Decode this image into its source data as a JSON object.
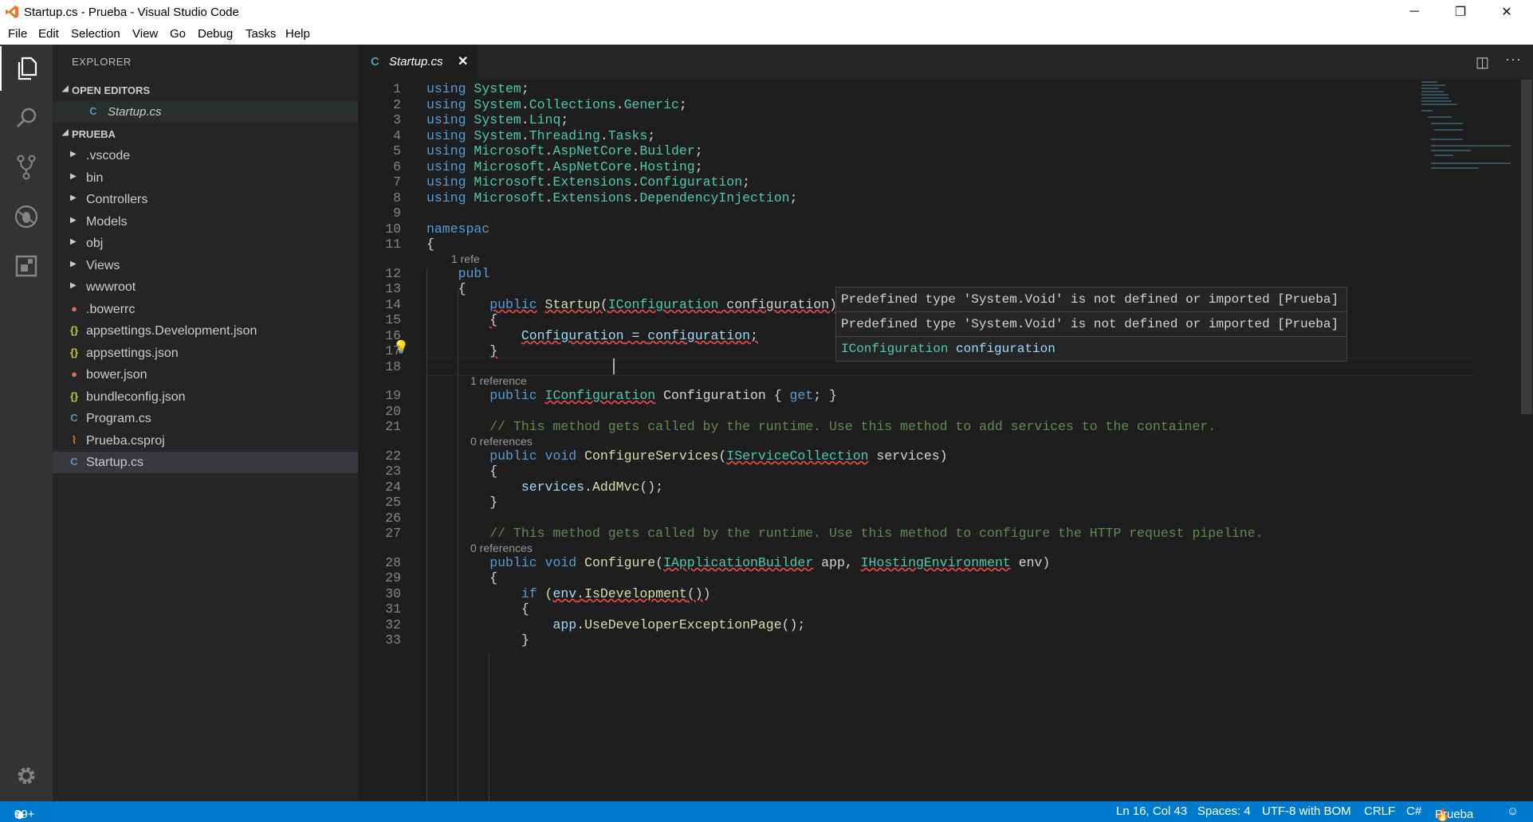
{
  "window": {
    "title": "Startup.cs - Prueba - Visual Studio Code",
    "controls": {
      "minimize": "─",
      "restore": "❐",
      "close": "✕"
    }
  },
  "menu": [
    "File",
    "Edit",
    "Selection",
    "View",
    "Go",
    "Debug",
    "Tasks",
    "Help"
  ],
  "explorer": {
    "header": "EXPLORER",
    "open_editors_label": "OPEN EDITORS",
    "open_editors": [
      {
        "name": "Startup.cs",
        "icon": "csharp-icon"
      }
    ],
    "project_label": "PRUEBA",
    "folders": [
      ".vscode",
      "bin",
      "Controllers",
      "Models",
      "obj",
      "Views",
      "wwwroot"
    ],
    "files": [
      {
        "name": ".bowerrc",
        "icon": "bower-icon",
        "glyph": "●",
        "color": "#e0704a"
      },
      {
        "name": "appsettings.Development.json",
        "icon": "json-icon",
        "glyph": "{}",
        "color": "#cbcb41"
      },
      {
        "name": "appsettings.json",
        "icon": "json-icon",
        "glyph": "{}",
        "color": "#cbcb41"
      },
      {
        "name": "bower.json",
        "icon": "bower-icon",
        "glyph": "●",
        "color": "#e0704a"
      },
      {
        "name": "bundleconfig.json",
        "icon": "json-icon",
        "glyph": "{}",
        "color": "#cbcb41"
      },
      {
        "name": "Program.cs",
        "icon": "csharp-icon",
        "glyph": "C",
        "color": "#519aba"
      },
      {
        "name": "Prueba.csproj",
        "icon": "rss-icon",
        "glyph": "⌇",
        "color": "#e37933"
      },
      {
        "name": "Startup.cs",
        "icon": "csharp-icon",
        "glyph": "C",
        "color": "#519aba"
      }
    ]
  },
  "editor": {
    "tab": {
      "label": "Startup.cs",
      "close": "✕"
    },
    "lines": [
      {
        "n": "1",
        "html": "<span class=\"kw\">using</span> <span class=\"ty\">System</span>;"
      },
      {
        "n": "2",
        "html": "<span class=\"kw\">using</span> <span class=\"ty\">System</span>.<span class=\"ty\">Collections</span>.<span class=\"ty\">Generic</span>;"
      },
      {
        "n": "3",
        "html": "<span class=\"kw\">using</span> <span class=\"ty\">System</span>.<span class=\"ty\">Linq</span>;"
      },
      {
        "n": "4",
        "html": "<span class=\"kw\">using</span> <span class=\"ty\">System</span>.<span class=\"ty\">Threading</span>.<span class=\"ty\">Tasks</span>;"
      },
      {
        "n": "5",
        "html": "<span class=\"kw\">using</span> <span class=\"ty\">Microsoft</span>.<span class=\"ty\">AspNetCore</span>.<span class=\"ty\">Builder</span>;"
      },
      {
        "n": "6",
        "html": "<span class=\"kw\">using</span> <span class=\"ty\">Microsoft</span>.<span class=\"ty\">AspNetCore</span>.<span class=\"ty\">Hosting</span>;"
      },
      {
        "n": "7",
        "html": "<span class=\"kw\">using</span> <span class=\"ty\">Microsoft</span>.<span class=\"ty\">Extensions</span>.<span class=\"ty\">Configuration</span>;"
      },
      {
        "n": "8",
        "html": "<span class=\"kw\">using</span> <span class=\"ty\">Microsoft</span>.<span class=\"ty\">Extensions</span>.<span class=\"ty\">DependencyInjection</span>;"
      },
      {
        "n": "9",
        "html": ""
      },
      {
        "n": "10",
        "html": "<span class=\"kw\">namespac</span>"
      },
      {
        "n": "11",
        "html": "{"
      },
      {
        "lens": "1 refe",
        "indent": 1
      },
      {
        "n": "12",
        "html": "    <span class=\"kw\">publ</span>"
      },
      {
        "n": "13",
        "html": "    {"
      },
      {
        "n": "14",
        "html": "        <span class=\"kw err\">public</span> <span class=\"fn err\">Startup</span><span class=\"err\">(</span><span class=\"ty err\">IConfiguration</span><span class=\"err\"> configuration)</span>"
      },
      {
        "n": "15",
        "html": "        <span class=\"err\">{</span>"
      },
      {
        "n": "16",
        "html": "            <span class=\"id err\">Configuration</span><span class=\"err\"> = </span><span class=\"id err\">configuration</span><span class=\"err\">;</span>"
      },
      {
        "n": "17",
        "html": "        <span class=\"err\">}</span>"
      },
      {
        "n": "18",
        "html": ""
      },
      {
        "lens": "1 reference",
        "indent": 2
      },
      {
        "n": "19",
        "html": "        <span class=\"kw\">public</span> <span class=\"ty err\">IConfiguration</span> Configuration { <span class=\"kw\">get</span>; }"
      },
      {
        "n": "20",
        "html": ""
      },
      {
        "n": "21",
        "html": "        <span class=\"cm\">// This method gets called by the runtime. Use this method to add services to the container.</span>"
      },
      {
        "lens": "0 references",
        "indent": 2
      },
      {
        "n": "22",
        "html": "        <span class=\"kw\">public</span> <span class=\"kw\">void</span> <span class=\"fn\">ConfigureServices</span>(<span class=\"ty err\">IServiceCollection</span> services)"
      },
      {
        "n": "23",
        "html": "        {"
      },
      {
        "n": "24",
        "html": "            <span class=\"id\">services</span>.<span class=\"fn\">AddMvc</span>();"
      },
      {
        "n": "25",
        "html": "        }"
      },
      {
        "n": "26",
        "html": ""
      },
      {
        "n": "27",
        "html": "        <span class=\"cm\">// This method gets called by the runtime. Use this method to configure the HTTP request pipeline.</span>"
      },
      {
        "lens": "0 references",
        "indent": 2
      },
      {
        "n": "28",
        "html": "        <span class=\"kw\">public</span> <span class=\"kw\">void</span> <span class=\"fn\">Configure</span>(<span class=\"ty err\">IApplicationBuilder</span> app, <span class=\"ty err\">IHostingEnvironment</span> env)"
      },
      {
        "n": "29",
        "html": "        {"
      },
      {
        "n": "30",
        "html": "            <span class=\"kw\">if</span> (<span class=\"id err\">env</span><span class=\"err\">.</span><span class=\"fn err\">IsDevelopment</span><span class=\"err\">()</span>)"
      },
      {
        "n": "31",
        "html": "            {"
      },
      {
        "n": "32",
        "html": "                <span class=\"id\">app</span>.<span class=\"fn\">UseDeveloperExceptionPage</span>();"
      },
      {
        "n": "33",
        "html": "            }"
      }
    ],
    "hover": {
      "messages": [
        "Predefined type 'System.Void' is not defined or imported [Prueba]",
        "Predefined type 'System.Void' is not defined or imported [Prueba]"
      ],
      "signature_type": "IConfiguration",
      "signature_name": "configuration"
    }
  },
  "status": {
    "errors": "99+",
    "warnings": "0",
    "position": "Ln 16, Col 43",
    "spaces": "Spaces: 4",
    "encoding": "UTF-8 with BOM",
    "eol": "CRLF",
    "language": "C#",
    "project": "Prueba"
  }
}
